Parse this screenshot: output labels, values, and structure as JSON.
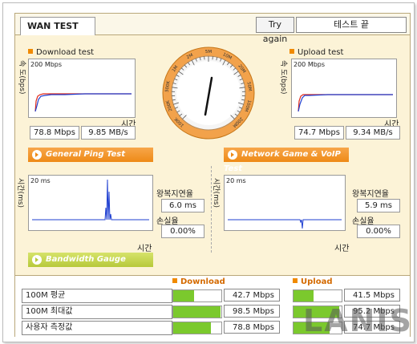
{
  "header": {
    "tab_label": "WAN TEST",
    "try_again_label": "Try again",
    "status_text": "테스트 끝"
  },
  "download": {
    "title": "Download test",
    "y_axis_label": "속 도(bps)",
    "y_max_label": "200 Mbps",
    "x_axis_label": "시간",
    "mbps": "78.8 Mbps",
    "mbs": "9.85 MB/s"
  },
  "upload": {
    "title": "Upload test",
    "y_axis_label": "속 도(bps)",
    "y_max_label": "200 Mbps",
    "x_axis_label": "시간",
    "mbps": "74.7 Mbps",
    "mbs": "9.34 MB/s"
  },
  "gauge": {
    "tick_labels": [
      "100K",
      "200K",
      "500K",
      "1M",
      "2M",
      "5M",
      "10M",
      "20M",
      "50M",
      "100M",
      "200M"
    ],
    "needle_value_label": "100M"
  },
  "ping": {
    "banner": "General Ping Test",
    "y_axis_label": "시간(ms)",
    "y_max_label": "20 ms",
    "x_axis_label": "시간",
    "latency_label": "왕복지연율",
    "latency_value": "6.0 ms",
    "loss_label": "손실율",
    "loss_value": "0.00%"
  },
  "game": {
    "banner": "Network Game & VoIP Test",
    "y_axis_label": "시간(ms)",
    "y_max_label": "20 ms",
    "x_axis_label": "시간",
    "latency_label": "왕복지연율",
    "latency_value": "5.9 ms",
    "loss_label": "손실율",
    "loss_value": "0.00%"
  },
  "bandwidth": {
    "banner": "Bandwidth Gauge",
    "download_header": "Download",
    "upload_header": "Upload",
    "rows": [
      {
        "label": "100M 평균",
        "download": "42.7 Mbps",
        "download_fraction": 0.43,
        "upload": "41.5 Mbps",
        "upload_fraction": 0.42
      },
      {
        "label": "100M 최대값",
        "download": "98.5 Mbps",
        "download_fraction": 0.98,
        "upload": "95.2 Mbps",
        "upload_fraction": 0.95
      },
      {
        "label": "사용자 측정값",
        "download": "78.8 Mbps",
        "download_fraction": 0.79,
        "upload": "74.7 Mbps",
        "upload_fraction": 0.75
      }
    ]
  },
  "watermark": "LANIS",
  "colors": {
    "panel_bg": "#fcf3d7",
    "banner_orange": "#ee8a17",
    "banner_green": "#b7c93a",
    "bar_fill": "#7bc92d",
    "chart_line_blue": "#1f3fd1",
    "chart_line_red": "#e02a1a"
  }
}
